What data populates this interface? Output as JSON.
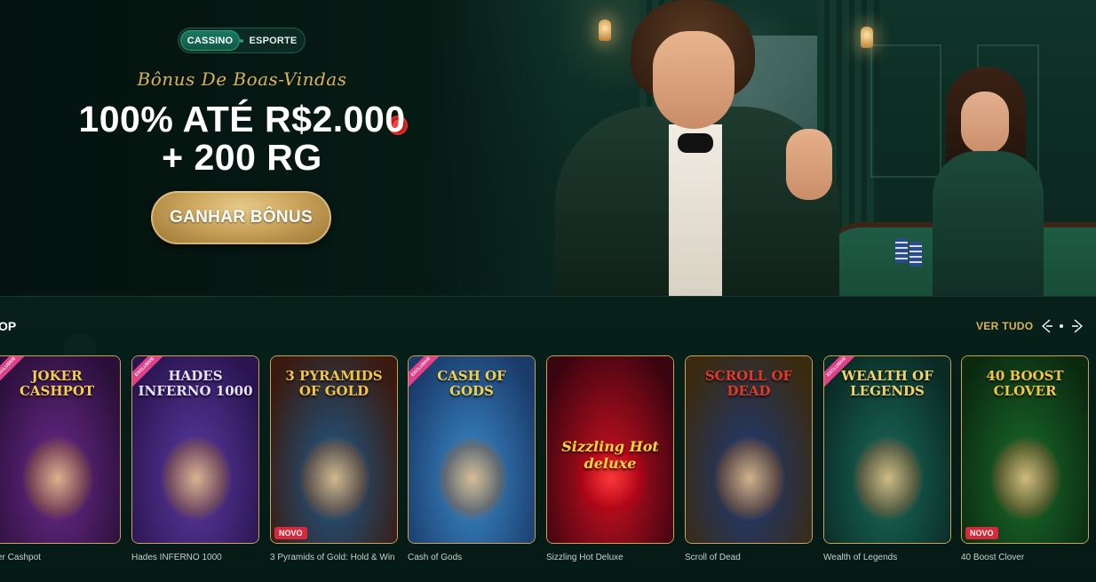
{
  "hero": {
    "tabs": [
      {
        "label": "CASSINO",
        "active": true
      },
      {
        "label": "ESPORTE",
        "active": false
      }
    ],
    "subtitle": "Bônus De Boas-Vindas",
    "headline_line1": "100% ATÉ R$2.000",
    "headline_line2": "+ 200 RG",
    "cta_label": "GANHAR BÔNUS"
  },
  "section": {
    "title": "OP",
    "see_all_label": "VER TUDO",
    "prev_icon": "chevron-left-icon",
    "next_icon": "chevron-right-icon"
  },
  "games": [
    {
      "name": "ker Cashpot",
      "art_title": "JOKER CASHPOT",
      "exclusive": true,
      "new": false,
      "colors": [
        "#6a2a8a",
        "#2a0f3a"
      ]
    },
    {
      "name": "Hades INFERNO 1000",
      "art_title": "HADES INFERNO 1000",
      "exclusive": true,
      "new": false,
      "colors": [
        "#5a3aa0",
        "#2a1450"
      ]
    },
    {
      "name": "3 Pyramids of Gold: Hold & Win",
      "art_title": "3 PYRAMIDS OF GOLD",
      "exclusive": false,
      "new": true,
      "colors": [
        "#1e5a8a",
        "#3a1a10"
      ]
    },
    {
      "name": "Cash of Gods",
      "art_title": "CASH OF GODS",
      "exclusive": true,
      "new": false,
      "colors": [
        "#3a8ac8",
        "#1a3a6a"
      ]
    },
    {
      "name": "Sizzling Hot Deluxe",
      "art_title": "Sizzling Hot deluxe",
      "exclusive": false,
      "new": false,
      "colors": [
        "#d01020",
        "#3a0410"
      ]
    },
    {
      "name": "Scroll of Dead",
      "art_title": "SCROLL OF DEAD",
      "exclusive": false,
      "new": false,
      "colors": [
        "#1e3a7a",
        "#3a2a10"
      ]
    },
    {
      "name": "Wealth of Legends",
      "art_title": "WEALTH OF LEGENDS",
      "exclusive": true,
      "new": false,
      "colors": [
        "#1a6a5a",
        "#0a2a24"
      ]
    },
    {
      "name": "40 Boost Clover",
      "art_title": "40 BOOST CLOVER",
      "exclusive": false,
      "new": true,
      "colors": [
        "#1a6a2a",
        "#0a2a10"
      ]
    }
  ],
  "badges": {
    "exclusive": "EXCLUSIVE",
    "new": "NOVO"
  },
  "colors": {
    "accent_gold": "#d9b25c",
    "active_tab": "#1a7a60",
    "background": "#071a15"
  }
}
